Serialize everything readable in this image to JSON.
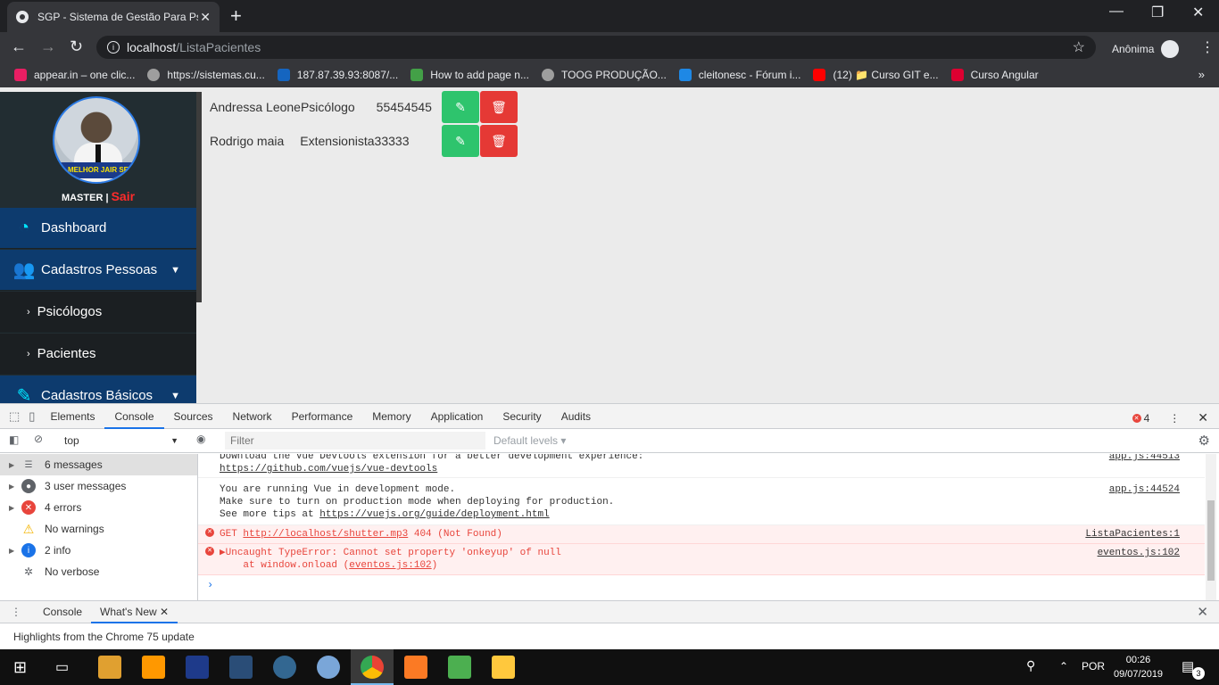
{
  "browser": {
    "tab_title": "SGP - Sistema de Gestão Para Psi",
    "tab_close": "✕",
    "new_tab": "+",
    "window_controls": [
      "—",
      "❐",
      "✕"
    ],
    "url_host": "localhost",
    "url_path": "/ListaPacientes",
    "profile_label": "Anônima",
    "bookmarks": [
      {
        "label": "appear.in – one clic...",
        "color": "#e91e63"
      },
      {
        "label": "https://sistemas.cu...",
        "color": "#9e9e9e"
      },
      {
        "label": "187.87.39.93:8087/...",
        "color": "#1565c0"
      },
      {
        "label": "How to add page n...",
        "color": "#43a047"
      },
      {
        "label": "TOOG PRODUÇÃO...",
        "color": "#9e9e9e"
      },
      {
        "label": "cleitonesc - Fórum i...",
        "color": "#1e88e5"
      },
      {
        "label": "(12) 📁 Curso GIT e...",
        "color": "#ff0000"
      },
      {
        "label": "Curso Angular",
        "color": "#dd0031"
      }
    ],
    "bookmarks_more": "»"
  },
  "sidebar": {
    "avatar_banner": "MELHOR JAIR SE ACOSTUMANDO",
    "user_role": "MASTER",
    "separator": " | ",
    "logout": "Sair",
    "items": [
      {
        "label": "Dashboard",
        "icon": "tachometer-icon",
        "glyph": "◔"
      },
      {
        "label": "Cadastros Pessoas",
        "icon": "users-icon",
        "glyph": "👥",
        "chevron": "▼"
      },
      {
        "label": "Psicólogos",
        "chevron": "›"
      },
      {
        "label": "Pacientes",
        "chevron": "›"
      },
      {
        "label": "Cadastros Básicos",
        "icon": "pencil-icon",
        "glyph": "✎",
        "chevron": "▼"
      }
    ]
  },
  "patients": [
    {
      "name": "Andressa Leone",
      "role": "Psicólogo",
      "code": "55454545"
    },
    {
      "name": "Rodrigo maia",
      "role": "Extensionista",
      "code": "33333"
    }
  ],
  "devtools": {
    "tabs": [
      "Elements",
      "Console",
      "Sources",
      "Network",
      "Performance",
      "Memory",
      "Application",
      "Security",
      "Audits"
    ],
    "active_tab": "Console",
    "error_count": "4",
    "context": "top",
    "filter_placeholder": "Filter",
    "levels": "Default levels ▾",
    "sidebar": [
      {
        "label": "6 messages",
        "icon": "list-icon"
      },
      {
        "label": "3 user messages",
        "icon": "user-icon"
      },
      {
        "label": "4 errors",
        "icon": "error-icon"
      },
      {
        "label": "No warnings",
        "icon": "warning-icon"
      },
      {
        "label": "2 info",
        "icon": "info-icon"
      },
      {
        "label": "No verbose",
        "icon": "bug-icon"
      }
    ],
    "messages": [
      {
        "type": "log",
        "lines": [
          "Download the Vue Devtools extension for a better development experience:"
        ],
        "link": "https://github.com/vuejs/vue-devtools",
        "src": "app.js:44513"
      },
      {
        "type": "log",
        "lines": [
          "You are running Vue in development mode.",
          "Make sure to turn on production mode when deploying for production.",
          "See more tips at "
        ],
        "link": "https://vuejs.org/guide/deployment.html",
        "src": "app.js:44524"
      },
      {
        "type": "error",
        "pre": "GET ",
        "link": "http://localhost/shutter.mp3",
        "post": " 404 (Not Found)",
        "src": "ListaPacientes:1"
      },
      {
        "type": "error",
        "lines": [
          "▶Uncaught TypeError: Cannot set property 'onkeyup' of null"
        ],
        "line2_pre": "    at window.onload (",
        "line2_link": "eventos.js:102",
        "line2_post": ")",
        "src": "eventos.js:102"
      }
    ],
    "prompt": "›",
    "drawer_tabs": [
      "Console",
      "What's New"
    ],
    "drawer_active": "What's New",
    "whatsnew_text": "Highlights from the Chrome 75 update"
  },
  "taskbar": {
    "language": "POR",
    "time": "00:26",
    "date": "09/07/2019",
    "notifications": "3",
    "apps": [
      {
        "name": "task-view-icon",
        "color": "#101010"
      },
      {
        "name": "java-icon",
        "color": "#e0a030"
      },
      {
        "name": "sublime-icon",
        "color": "#ff9800"
      },
      {
        "name": "maker-icon",
        "color": "#1e3a8a"
      },
      {
        "name": "mysql-workbench-icon",
        "color": "#2a4d77"
      },
      {
        "name": "postgres-icon",
        "color": "#336791"
      },
      {
        "name": "paint-icon",
        "color": "#7aa6d8"
      },
      {
        "name": "chrome-icon",
        "color": "#4285f4"
      },
      {
        "name": "xampp-icon",
        "color": "#fb7a24"
      },
      {
        "name": "chart-app-icon",
        "color": "#4caf50"
      },
      {
        "name": "file-explorer-icon",
        "color": "#ffc83d"
      }
    ]
  }
}
